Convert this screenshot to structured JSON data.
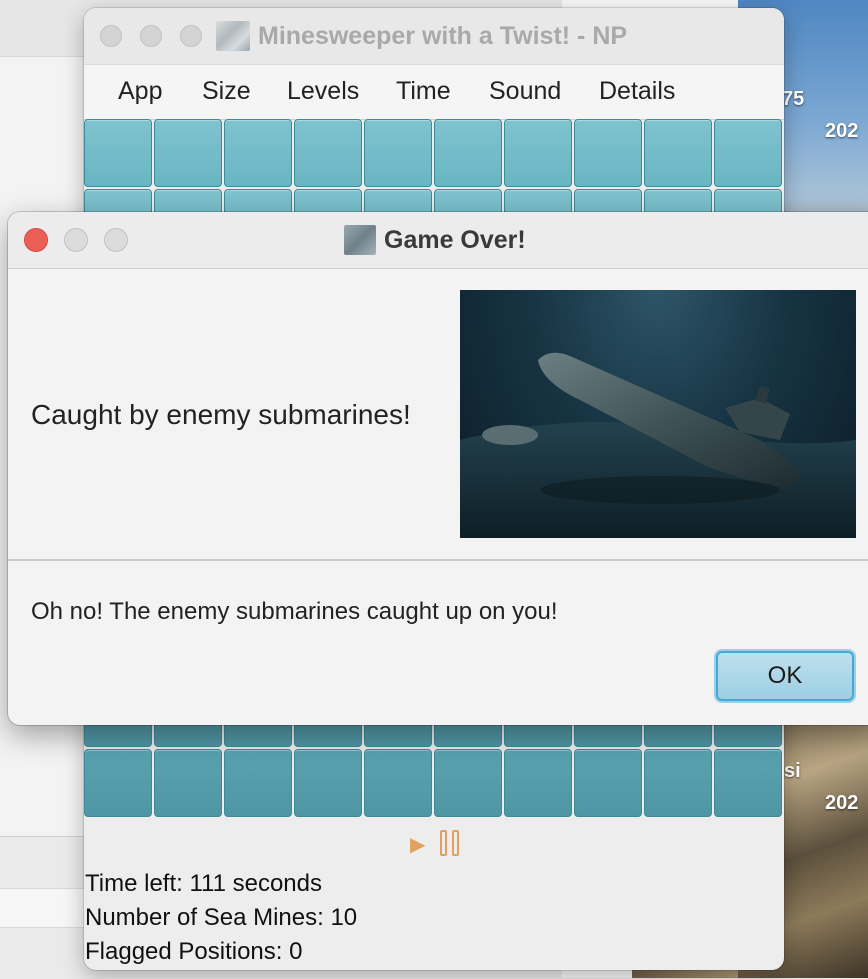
{
  "game_window": {
    "title": "Minesweeper with a Twist! - NP",
    "menu": [
      "App",
      "Size",
      "Levels",
      "Time",
      "Sound",
      "Details"
    ],
    "grid_columns": 10,
    "status": {
      "time_left": "Time left: 111 seconds",
      "sea_mines": "Number of Sea Mines: 10",
      "flagged": "Flagged Positions: 0"
    },
    "icons": [
      "app-icon",
      "play-icon",
      "pause-icon"
    ]
  },
  "dialog": {
    "title": "Game Over!",
    "message": "Caught by enemy submarines!",
    "body": "Oh no! The enemy submarines caught up on you!",
    "ok_label": "OK",
    "image": "sunken-submarine-image"
  },
  "desktop": {
    "labels": [
      "75",
      "202",
      "si",
      "202"
    ]
  },
  "colors": {
    "tile": "#6ab5c3",
    "tile_border": "#3d8a98",
    "control_icon": "#e1a25f",
    "close_red": "#ec5f57",
    "ok_blue": "#4aa6d2"
  }
}
